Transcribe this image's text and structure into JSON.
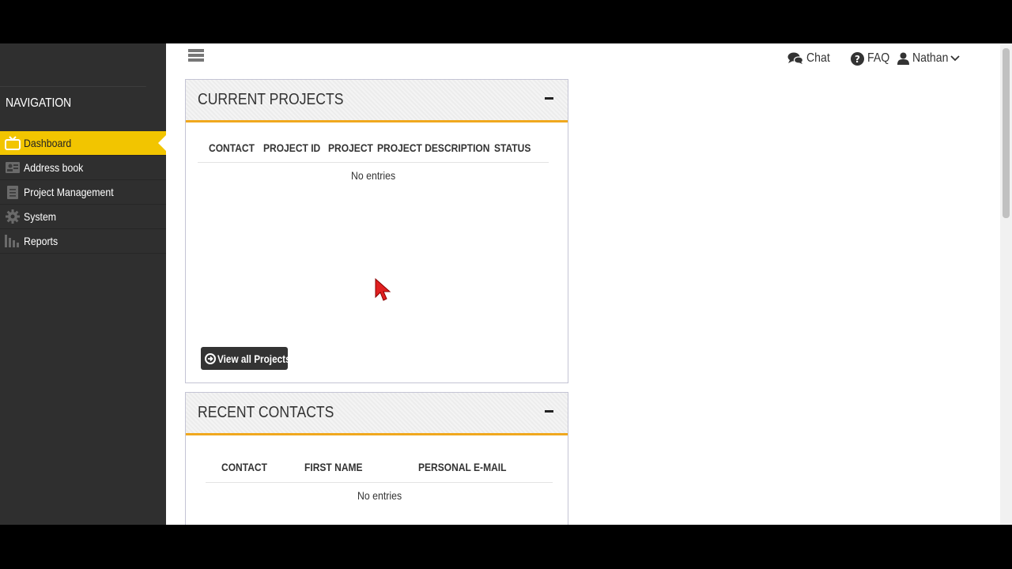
{
  "sidebar": {
    "header": "NAVIGATION",
    "items": [
      {
        "label": "Dashboard",
        "icon": "tv-icon",
        "active": true
      },
      {
        "label": "Address book",
        "icon": "address-book-icon",
        "active": false
      },
      {
        "label": "Project Management",
        "icon": "document-icon",
        "active": false
      },
      {
        "label": "System",
        "icon": "gear-icon",
        "active": false
      },
      {
        "label": "Reports",
        "icon": "bar-chart-icon",
        "active": false
      }
    ]
  },
  "topbar": {
    "chat_label": "Chat",
    "faq_label": "FAQ",
    "user_label": "Nathan"
  },
  "projects_panel": {
    "title": "CURRENT PROJECTS",
    "columns": [
      "CONTACT",
      "PROJECT ID",
      "PROJECT",
      "PROJECT DESCRIPTION",
      "STATUS"
    ],
    "empty_text": "No entries",
    "button_label": "View all Projects"
  },
  "contacts_panel": {
    "title": "RECENT CONTACTS",
    "columns": [
      "CONTACT",
      "FIRST NAME",
      "PERSONAL E-MAIL"
    ],
    "empty_text": "No entries"
  },
  "colors": {
    "accent": "#f2c500",
    "panel_underline": "#f0a81e",
    "sidebar_bg": "#2f2f2f"
  }
}
